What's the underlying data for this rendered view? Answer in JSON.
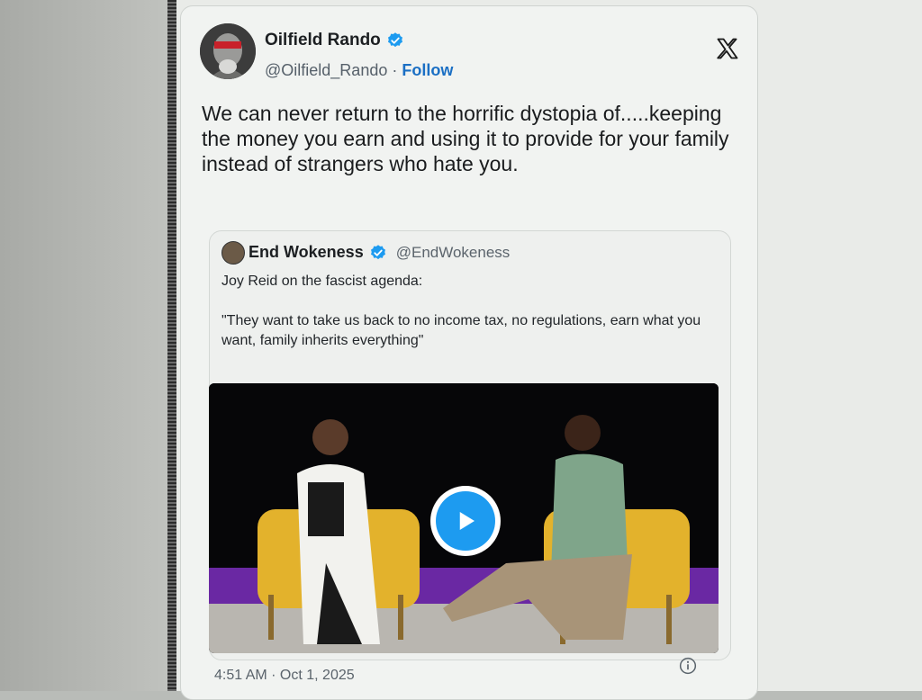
{
  "tweet": {
    "author_name": "Oilfield Rando",
    "handle": "@Oilfield_Rando",
    "separator": "·",
    "follow_label": "Follow",
    "text": "We can never return to the horrific dystopia of.....keeping the money you earn and using it to provide for your family instead of strangers who hate you.",
    "timestamp": "4:51 AM · Oct 1, 2025"
  },
  "quoted": {
    "author_name": "End Wokeness",
    "handle": "@EndWokeness",
    "line1": "Joy Reid on the fascist agenda:",
    "line2": "\"They want to take us back to no income tax, no regulations, earn what you want, family inherits everything\""
  },
  "icons": {
    "verified": "verified-badge-icon",
    "platform": "x-logo-icon",
    "play": "play-icon",
    "info": "info-icon"
  },
  "colors": {
    "verified": "#1d9bf0",
    "follow": "#1b6fc4",
    "play_button": "#1d9bf0",
    "purple_stage": "#7a2fb0",
    "chair_yellow": "#e6b52e"
  }
}
